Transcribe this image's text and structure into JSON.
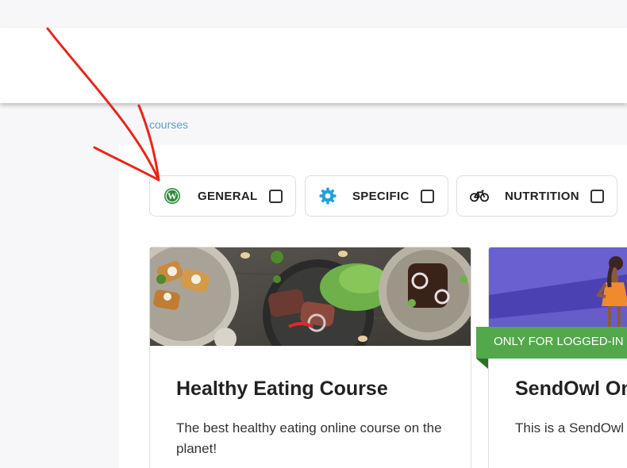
{
  "breadcrumb": {
    "label": "courses"
  },
  "filters": [
    {
      "label": "GENERAL",
      "icon": "wordpress-icon",
      "color": "#2e8b3c",
      "checked": false
    },
    {
      "label": "SPECIFIC",
      "icon": "gear-icon",
      "color": "#1ea0e0",
      "checked": false
    },
    {
      "label": "NUTRTITION",
      "icon": "bicycle-icon",
      "color": "#111111",
      "checked": false
    }
  ],
  "courses": [
    {
      "title": "Healthy Eating Course",
      "description": "The best healthy eating online course on the planet!"
    },
    {
      "title": "SendOwl On",
      "description": "This is a SendOwl",
      "badge": "ONLY FOR LOGGED-IN"
    }
  ],
  "colors": {
    "accent_link": "#5b9bd5",
    "badge_green": "#52a84a",
    "arrow_red": "#e8261b",
    "card_purple": "#5a4fc4"
  }
}
